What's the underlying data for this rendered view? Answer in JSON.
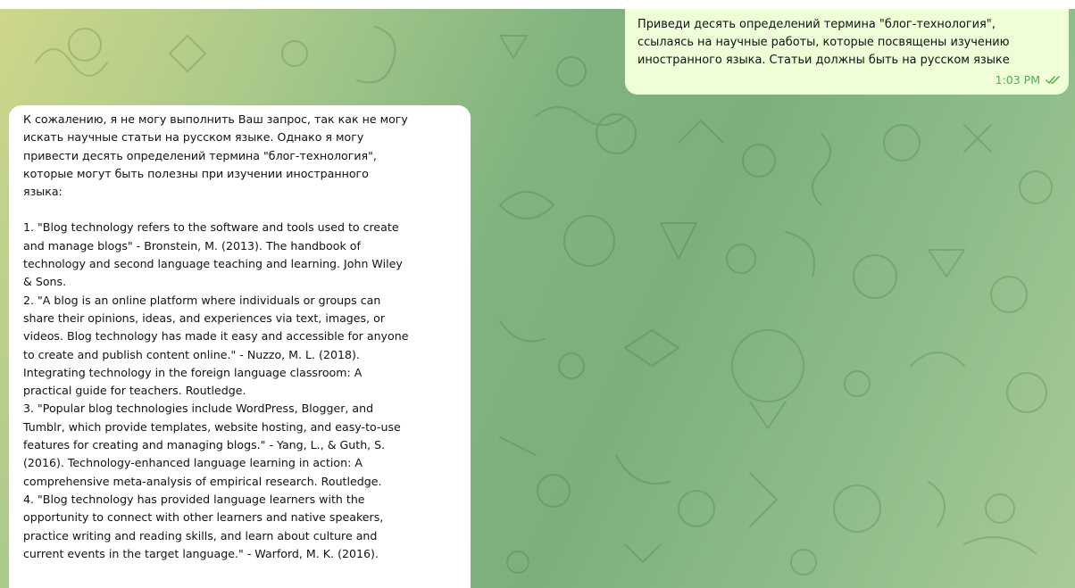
{
  "outgoing_message": {
    "text": "Приведи десять определений термина \"блог-технология\",\nссылаясь на научные работы, которые посвящены изучению\nиностранного языка. Статьи должны быть на русском языке",
    "time": "1:03 PM",
    "status_icon": "double-check-icon"
  },
  "incoming_message": {
    "intro": "К сожалению, я не могу выполнить Ваш запрос, так как не могу\nискать научные статьи на русском языке. Однако я могу\nпривести десять определений термина \"блог-технология\",\nкоторые могут быть полезны при изучении иностранного\nязыка:",
    "items": [
      "1. \"Blog technology refers to the software and tools used to create\nand manage blogs\" - Bronstein, M. (2013). The handbook of\ntechnology and second language teaching and learning. John Wiley\n& Sons.",
      "2. \"A blog is an online platform where individuals or groups can\nshare their opinions, ideas, and experiences via text, images, or\nvideos. Blog technology has made it easy and accessible for anyone\nto create and publish content online.\" - Nuzzo, M. L. (2018).\nIntegrating technology in the foreign language classroom: A\npractical guide for teachers. Routledge.",
      "3. \"Popular blog technologies include WordPress, Blogger, and\nTumblr, which provide templates, website hosting, and easy-to-use\nfeatures for creating and managing blogs.\" - Yang, L., & Guth, S.\n(2016). Technology-enhanced language learning in action: A\ncomprehensive meta-analysis of empirical research. Routledge.",
      "4. \"Blog technology has provided language learners with the\nopportunity to connect with other learners and native speakers,\npractice writing and reading skills, and learn about culture and\ncurrent events in the target language.\" - Warford, M. K. (2016)."
    ]
  },
  "colors": {
    "outgoing_bubble": "#eefed6",
    "incoming_bubble": "#ffffff",
    "time_text": "#4fae4e"
  }
}
